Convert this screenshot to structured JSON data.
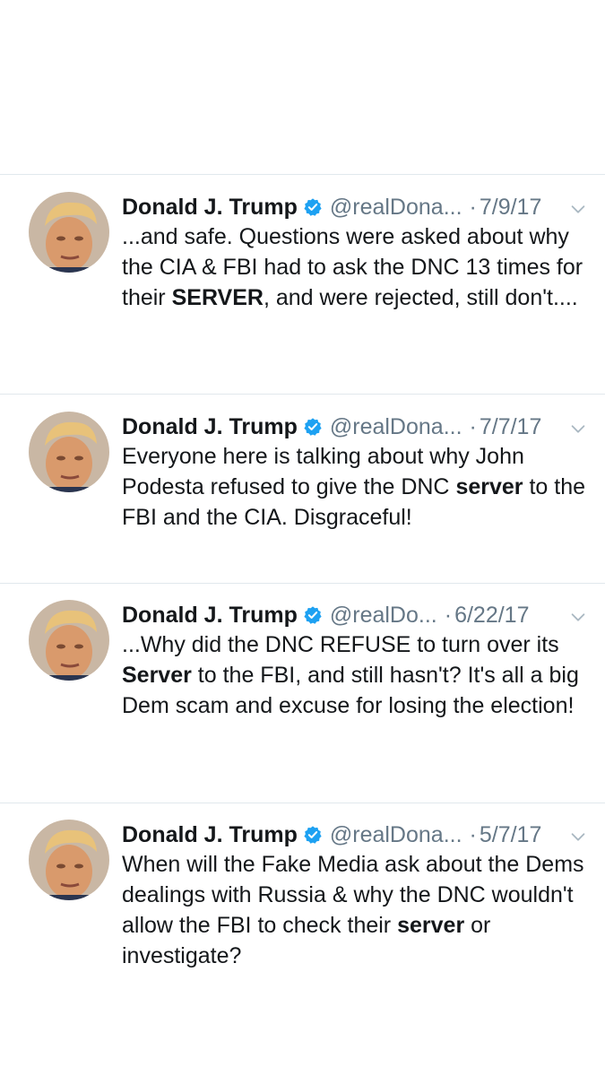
{
  "tweets": [
    {
      "name": "Donald J. Trump",
      "handle": "@realDona...",
      "date": "7/9/17",
      "parts": [
        {
          "t": "...and safe. Questions were asked about why the CIA & FBI had to ask the DNC 13 times for their ",
          "b": false
        },
        {
          "t": "SERVER",
          "b": true
        },
        {
          "t": ", and were rejected, still don't....",
          "b": false
        }
      ]
    },
    {
      "name": "Donald J. Trump",
      "handle": "@realDona...",
      "date": "7/7/17",
      "parts": [
        {
          "t": "Everyone here is talking about why John Podesta refused to give the DNC ",
          "b": false
        },
        {
          "t": "server",
          "b": true
        },
        {
          "t": " to the FBI and the CIA. Disgraceful!",
          "b": false
        }
      ]
    },
    {
      "name": "Donald J. Trump",
      "handle": "@realDo...",
      "date": "6/22/17",
      "parts": [
        {
          "t": "...Why did the DNC REFUSE to turn over its ",
          "b": false
        },
        {
          "t": "Server",
          "b": true
        },
        {
          "t": " to the FBI, and still hasn't? It's all a big Dem scam and excuse for losing the election!",
          "b": false
        }
      ]
    },
    {
      "name": "Donald J. Trump",
      "handle": "@realDona...",
      "date": "5/7/17",
      "parts": [
        {
          "t": "When will the Fake Media ask about the Dems dealings with Russia & why the DNC wouldn't allow the FBI to check their ",
          "b": false
        },
        {
          "t": "server",
          "b": true
        },
        {
          "t": " or investigate?",
          "b": false
        }
      ]
    }
  ],
  "icons": {
    "verified": "verified-badge-icon",
    "menu": "chevron-down-icon",
    "avatar": "profile-photo"
  },
  "colors": {
    "text": "#14171a",
    "secondary": "#657786",
    "verified": "#1da1f2",
    "divider": "#e1e8ed",
    "chevron": "#aab8c2"
  }
}
